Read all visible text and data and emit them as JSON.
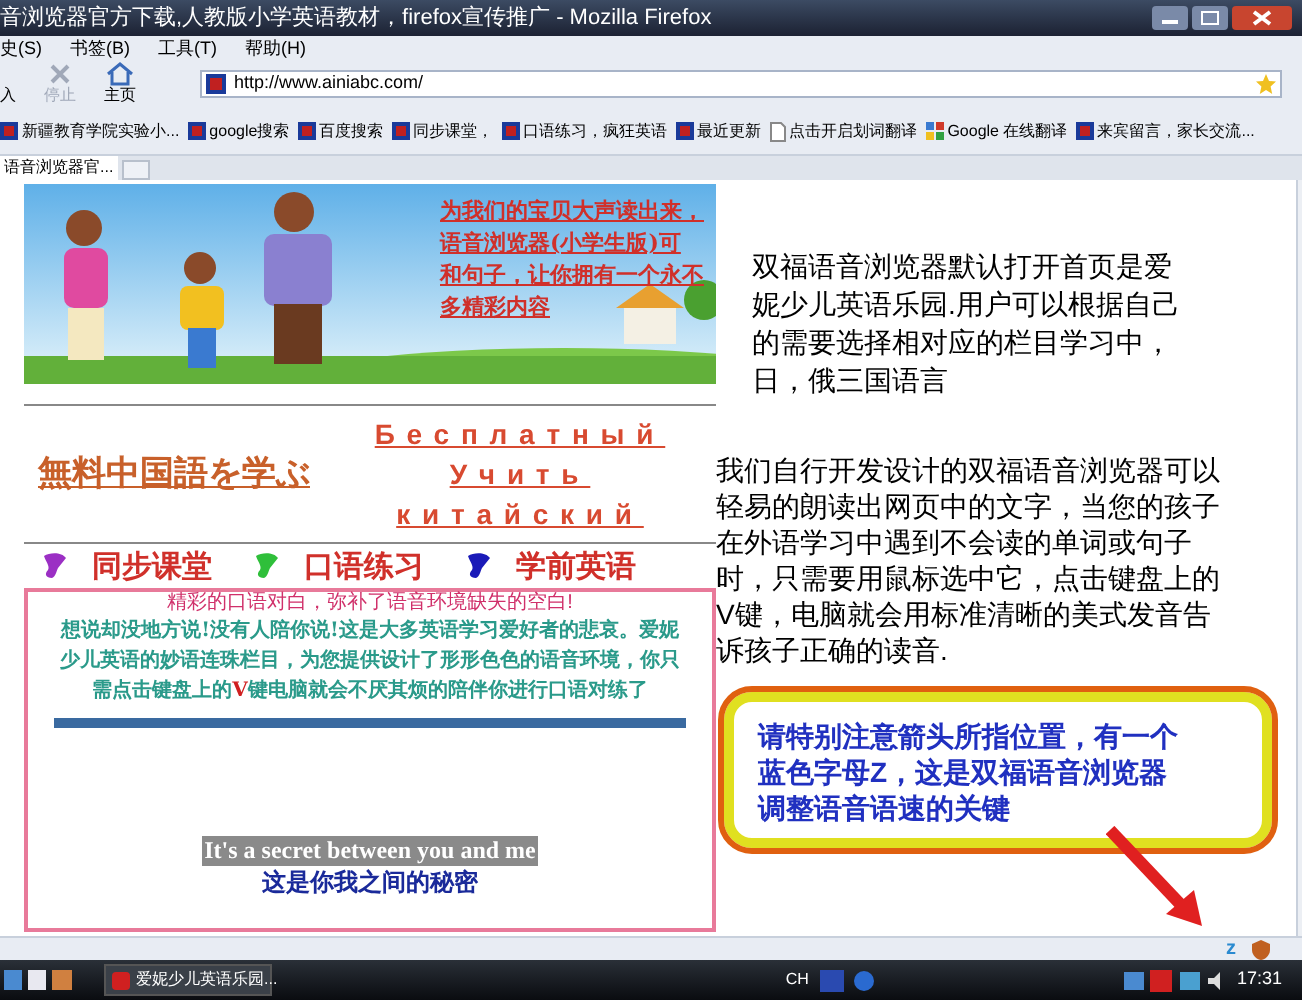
{
  "window": {
    "title": "音浏览器官方下载,人教版小学英语教材，firefox宣传推广 - Mozilla Firefox"
  },
  "menu": [
    "史(S)",
    "书签(B)",
    "工具(T)",
    "帮助(H)"
  ],
  "toolbar": {
    "buttons": [
      {
        "kind": "import",
        "label": "入",
        "disabled": false
      },
      {
        "kind": "stop",
        "label": "停止",
        "disabled": true
      },
      {
        "kind": "home",
        "label": "主页",
        "disabled": false
      }
    ],
    "address": "http://www.ainiabc.com/"
  },
  "bookmarks": [
    {
      "kind": "site",
      "label": "新疆教育学院实验小..."
    },
    {
      "kind": "site",
      "label": "google搜索"
    },
    {
      "kind": "site",
      "label": "百度搜索"
    },
    {
      "kind": "site",
      "label": "同步课堂，"
    },
    {
      "kind": "site",
      "label": "口语练习，疯狂英语"
    },
    {
      "kind": "site",
      "label": "最近更新"
    },
    {
      "kind": "page",
      "label": "点击开启划词翻译"
    },
    {
      "kind": "google",
      "label": "Google 在线翻译"
    },
    {
      "kind": "site",
      "label": "来宾留言，家长交流..."
    }
  ],
  "tabs": [
    {
      "label": "语音浏览器官...",
      "selected": true
    }
  ],
  "page": {
    "banner": {
      "kind": "picture",
      "lines": [
        "为我们的宝贝大声读出来，",
        "语音浏览器(小学生版)可",
        "和句子，让你拥有一个永不",
        "多精彩内容"
      ]
    },
    "japanese": "無料中国語を学ぶ",
    "russian": "Бесплатный Учить китайский",
    "nav": [
      {
        "label": "同步课堂",
        "color": "#9b2fc4"
      },
      {
        "label": "口语练习",
        "color": "#2fbf3a"
      },
      {
        "label": "学前英语",
        "color": "#1a1ab8"
      }
    ],
    "box": {
      "heading": "精彩的口语对白，弥补了语音环境缺失的空白!",
      "text": "想说却没地方说!没有人陪你说!这是大多英语学习爱好者的悲哀。爱妮少儿英语的妙语连珠栏目，为您提供设计了形形色色的语音环境，你只需点击键盘上的**V**键电脑就会不厌其烦的陪伴你进行口语对练了",
      "subtitle_en": "It's a secret between you and me",
      "subtitle_zh": "这是你我之间的秘密"
    }
  },
  "notes": [
    "双福语音浏览器默认打开首页是爱妮少儿英语乐园.用户可以根据自己的需要选择相对应的栏目学习中，日，俄三国语言",
    "我们自行开发设计的双福语音浏览器可以轻易的朗读出网页中的文字，当您的孩子在外语学习中遇到不会读的单词或句子时，只需要用鼠标选中它，点击键盘上的V键，电脑就会用标准清晰的美式发音告诉孩子正确的读音."
  ],
  "callout": "请特别注意箭头所指位置，有一个蓝色字母Z，这是双福语音浏览器调整语音语速的关键",
  "status": {
    "z_label": "z"
  },
  "taskbar": {
    "task": "爱妮少儿英语乐园...",
    "lang": "CH",
    "clock": "17:31"
  }
}
